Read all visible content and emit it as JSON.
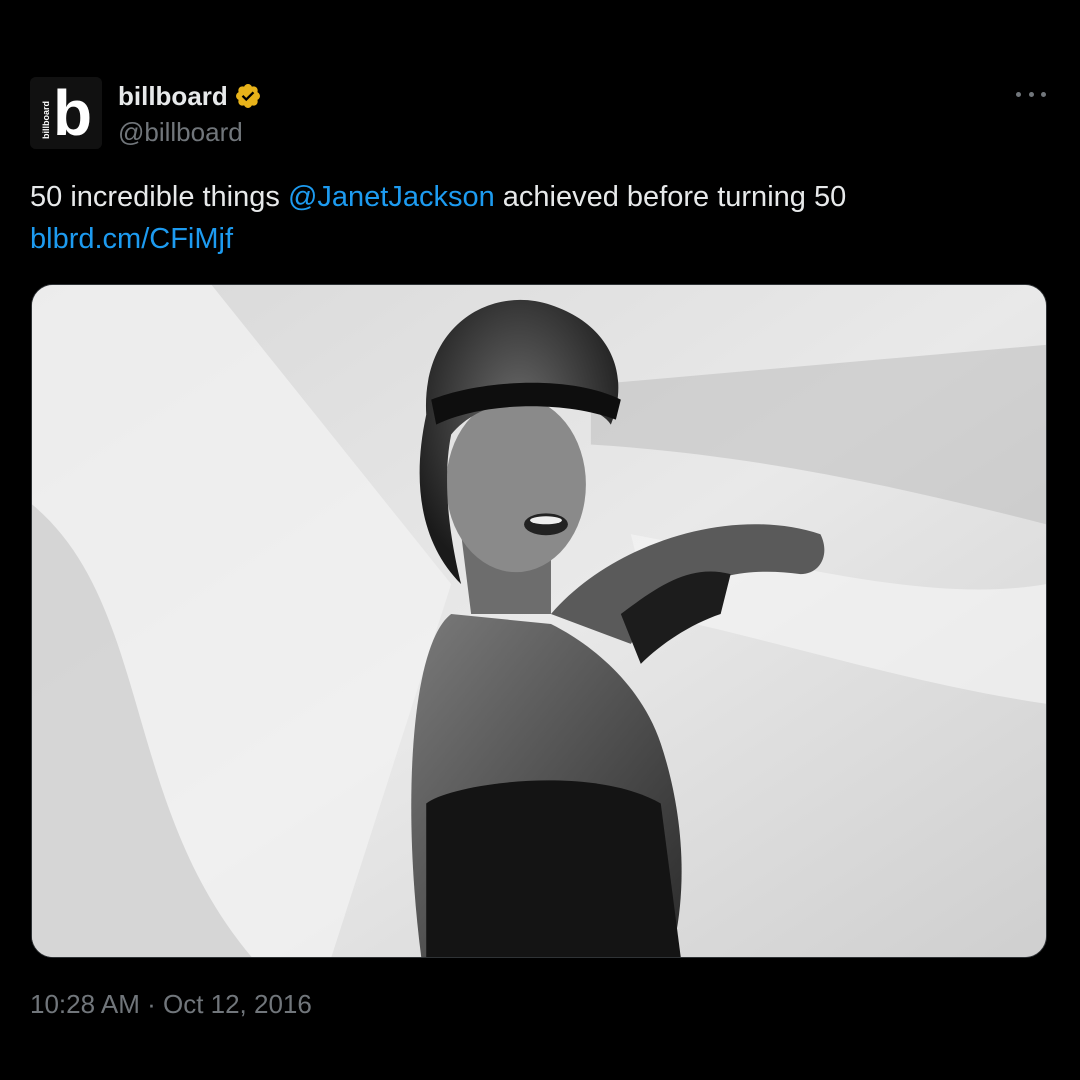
{
  "author": {
    "display_name": "billboard",
    "handle": "@billboard",
    "avatar_letter": "b",
    "avatar_wordmark": "billboard",
    "verified_color": "#e8b31a"
  },
  "tweet": {
    "text_before": "50 incredible things ",
    "mention": "@JanetJackson",
    "text_after": " achieved before turning 50",
    "link": "blbrd.cm/CFiMjf"
  },
  "meta": {
    "time": "10:28 AM",
    "separator": " · ",
    "date": "Oct 12, 2016"
  },
  "colors": {
    "background": "#000000",
    "text": "#e7e9ea",
    "secondary": "#71767b",
    "link": "#1d9bf0"
  },
  "icons": {
    "more": "more-icon",
    "verified": "verified-badge-icon"
  }
}
